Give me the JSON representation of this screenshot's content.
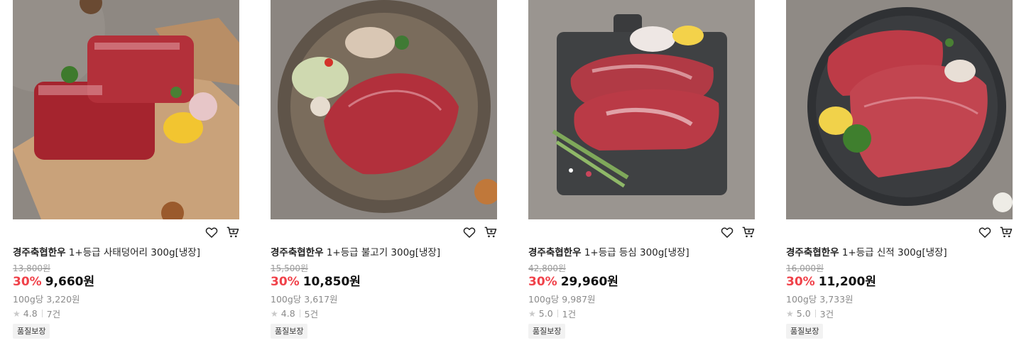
{
  "products": [
    {
      "brand": "경주축협한우",
      "name": "1+등급 사태덩어리 300g[냉장]",
      "original_price": "13,800원",
      "discount": "30%",
      "price": "9,660원",
      "unit_price": "100g당 3,220원",
      "rating": "4.8",
      "reviews": "7건",
      "badge": "품질보장"
    },
    {
      "brand": "경주축협한우",
      "name": "1+등급 불고기 300g[냉장]",
      "original_price": "15,500원",
      "discount": "30%",
      "price": "10,850원",
      "unit_price": "100g당 3,617원",
      "rating": "4.8",
      "reviews": "5건",
      "badge": "품질보장"
    },
    {
      "brand": "경주축협한우",
      "name": "1+등급 등심 300g[냉장]",
      "original_price": "42,800원",
      "discount": "30%",
      "price": "29,960원",
      "unit_price": "100g당 9,987원",
      "rating": "5.0",
      "reviews": "1건",
      "badge": "품질보장"
    },
    {
      "brand": "경주축협한우",
      "name": "1+등급 신적 300g[냉장]",
      "original_price": "16,000원",
      "discount": "30%",
      "price": "11,200원",
      "unit_price": "100g당 3,733원",
      "rating": "5.0",
      "reviews": "3건",
      "badge": "품질보장"
    }
  ],
  "icons": {
    "wishlist": "heart-outline-icon",
    "cart": "shopping-cart-icon",
    "rating": "star-icon"
  },
  "colors": {
    "discount": "#f0424a",
    "price": "#111111",
    "muted": "#8a8a8a",
    "badge_bg": "#f2f2f2"
  }
}
